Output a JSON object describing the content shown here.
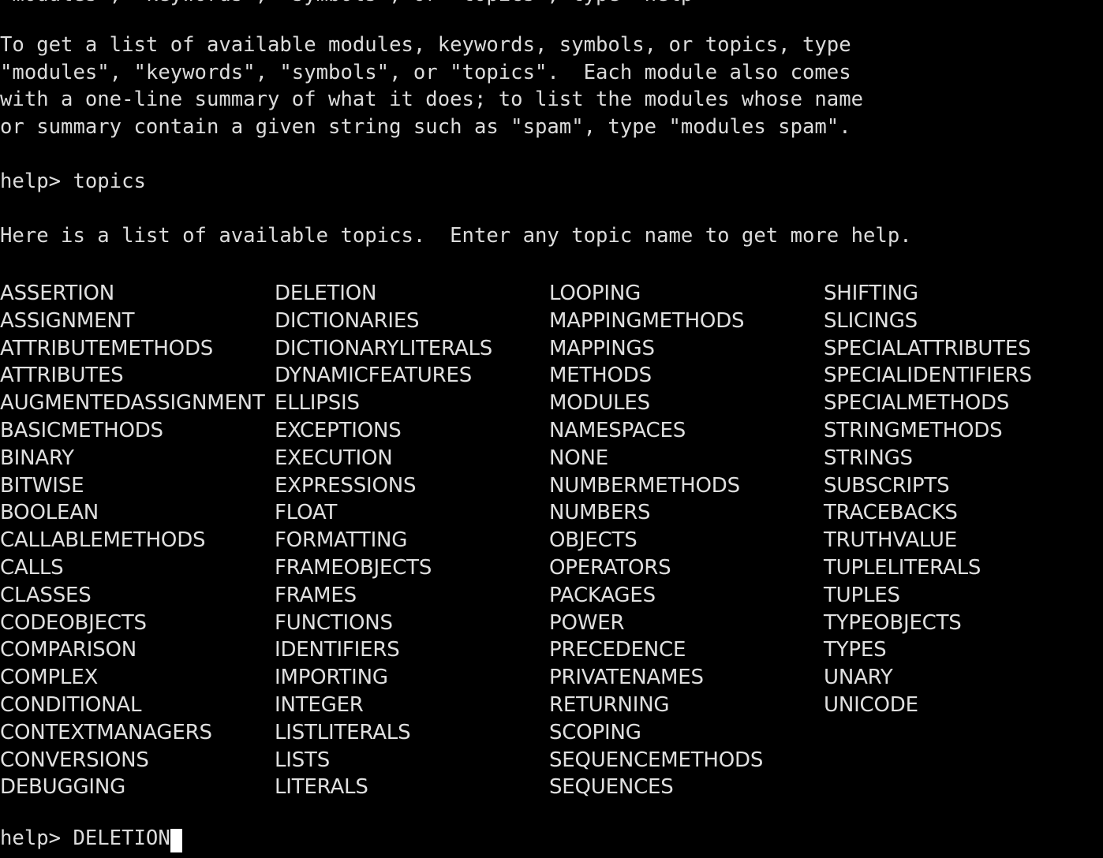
{
  "terminal": {
    "background_color": "#000000",
    "foreground_color": "#dcdcdc",
    "cursor_color": "#ffffff",
    "clipped_top_line": "\"modules\", \"keywords\", \"symbols\", or \"topics\", type \"help\"",
    "intro_lines": [
      "To get a list of available modules, keywords, symbols, or topics, type",
      "\"modules\", \"keywords\", \"symbols\", or \"topics\".  Each module also comes",
      "with a one-line summary of what it does; to list the modules whose name",
      "or summary contain a given string such as \"spam\", type \"modules spam\".",
      "",
      "help> topics",
      "",
      "Here is a list of available topics.  Enter any topic name to get more help.",
      ""
    ],
    "prompt_prefix": "help> ",
    "prompt_input": "DELETION"
  },
  "topics": {
    "columns": [
      [
        "ASSERTION",
        "ASSIGNMENT",
        "ATTRIBUTEMETHODS",
        "ATTRIBUTES",
        "AUGMENTEDASSIGNMENT",
        "BASICMETHODS",
        "BINARY",
        "BITWISE",
        "BOOLEAN",
        "CALLABLEMETHODS",
        "CALLS",
        "CLASSES",
        "CODEOBJECTS",
        "COMPARISON",
        "COMPLEX",
        "CONDITIONAL",
        "CONTEXTMANAGERS",
        "CONVERSIONS",
        "DEBUGGING"
      ],
      [
        "DELETION",
        "DICTIONARIES",
        "DICTIONARYLITERALS",
        "DYNAMICFEATURES",
        "ELLIPSIS",
        "EXCEPTIONS",
        "EXECUTION",
        "EXPRESSIONS",
        "FLOAT",
        "FORMATTING",
        "FRAMEOBJECTS",
        "FRAMES",
        "FUNCTIONS",
        "IDENTIFIERS",
        "IMPORTING",
        "INTEGER",
        "LISTLITERALS",
        "LISTS",
        "LITERALS"
      ],
      [
        "LOOPING",
        "MAPPINGMETHODS",
        "MAPPINGS",
        "METHODS",
        "MODULES",
        "NAMESPACES",
        "NONE",
        "NUMBERMETHODS",
        "NUMBERS",
        "OBJECTS",
        "OPERATORS",
        "PACKAGES",
        "POWER",
        "PRECEDENCE",
        "PRIVATENAMES",
        "RETURNING",
        "SCOPING",
        "SEQUENCEMETHODS",
        "SEQUENCES"
      ],
      [
        "SHIFTING",
        "SLICINGS",
        "SPECIALATTRIBUTES",
        "SPECIALIDENTIFIERS",
        "SPECIALMETHODS",
        "STRINGMETHODS",
        "STRINGS",
        "SUBSCRIPTS",
        "TRACEBACKS",
        "TRUTHVALUE",
        "TUPLELITERALS",
        "TUPLES",
        "TYPEOBJECTS",
        "TYPES",
        "UNARY",
        "UNICODE"
      ]
    ]
  }
}
